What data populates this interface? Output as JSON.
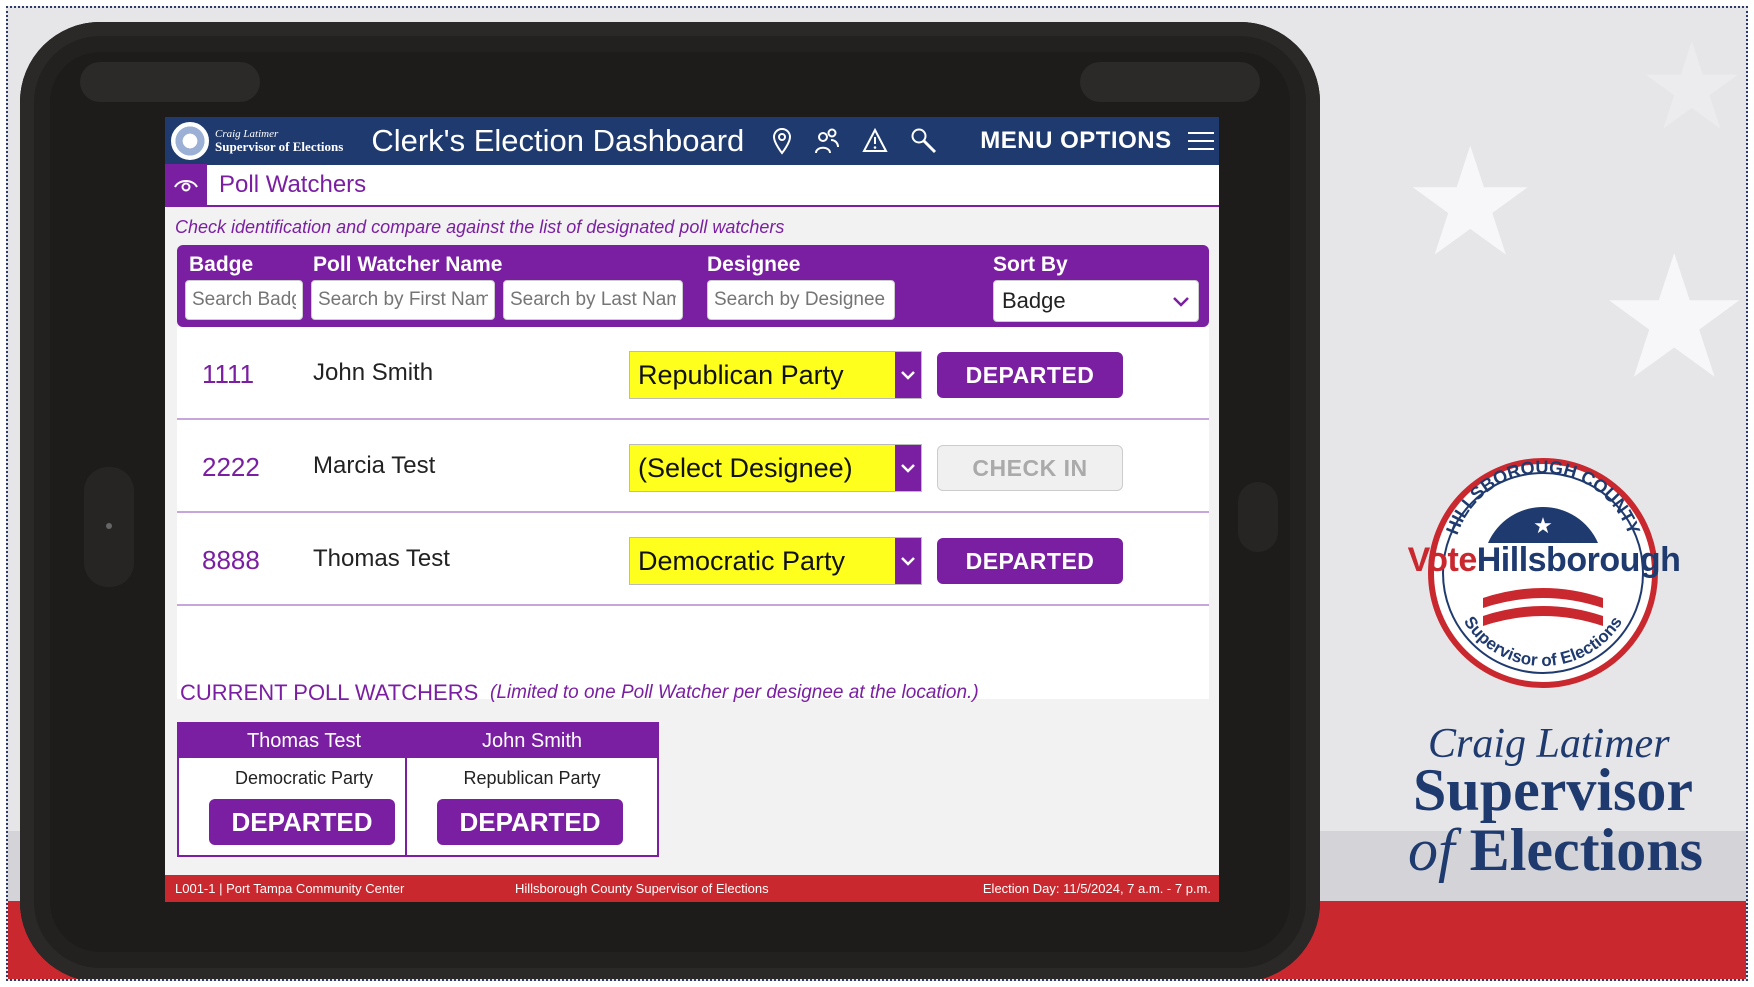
{
  "app": {
    "logo_top": "Craig Latimer",
    "logo_main": "Supervisor of Elections",
    "title": "Clerk's Election Dashboard",
    "icons": [
      "location-pin-icon",
      "users-icon",
      "warning-icon",
      "search-icon"
    ],
    "menu_label": "MENU OPTIONS"
  },
  "section": {
    "title": "Poll Watchers",
    "instructions": "Check identification and compare against the list of designated poll watchers"
  },
  "filters": {
    "badge_label": "Badge",
    "name_label": "Poll Watcher Name",
    "designee_label": "Designee",
    "sort_label": "Sort By",
    "badge_placeholder": "Search Badge",
    "first_placeholder": "Search by First Name",
    "last_placeholder": "Search by Last Name",
    "designee_placeholder": "Search by Designee",
    "sort_value": "Badge"
  },
  "rows": [
    {
      "badge": "1111",
      "name": "John Smith",
      "designee": "Republican Party",
      "action": "DEPARTED",
      "action_enabled": true
    },
    {
      "badge": "2222",
      "name": "Marcia Test",
      "designee": "(Select Designee)",
      "action": "CHECK IN",
      "action_enabled": false
    },
    {
      "badge": "8888",
      "name": "Thomas Test",
      "designee": "Democratic Party",
      "action": "DEPARTED",
      "action_enabled": true
    }
  ],
  "current": {
    "heading": "CURRENT POLL WATCHERS",
    "note": "(Limited to one Poll Watcher per designee at the location.)",
    "cards": [
      {
        "name": "Thomas Test",
        "party": "Democratic Party",
        "button": "DEPARTED"
      },
      {
        "name": "John Smith",
        "party": "Republican Party",
        "button": "DEPARTED"
      }
    ]
  },
  "footer": {
    "location": "L001-1 | Port Tampa Community Center",
    "center": "Hillsborough County Supervisor of Elections",
    "right": "Election Day: 11/5/2024, 7 a.m. - 7 p.m."
  },
  "brand": {
    "ring_top": "HILLSBOROUGH COUNTY",
    "vote": "Vote",
    "hillsborough": "Hillsborough",
    "ring_bottom": "Supervisor of Elections",
    "craig": "Craig Latimer",
    "supervisor": "Supervisor",
    "of": "of",
    "elections": "Elections"
  },
  "colors": {
    "accent_purple": "#7b1fa2",
    "header_navy": "#1f3a6e",
    "footer_red": "#c8282e",
    "select_yellow": "#ffff1e"
  }
}
